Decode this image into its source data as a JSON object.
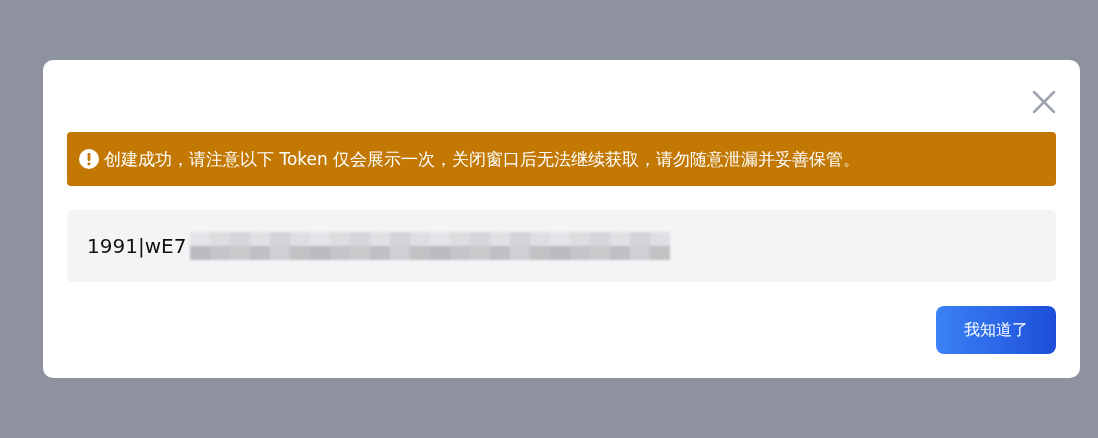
{
  "dialog": {
    "alert": "创建成功，请注意以下 Token 仅会展示一次，关闭窗口后无法继续获取，请勿随意泄漏并妥善保管。",
    "token": "1991|wE7",
    "confirm_button": "我知道了"
  }
}
